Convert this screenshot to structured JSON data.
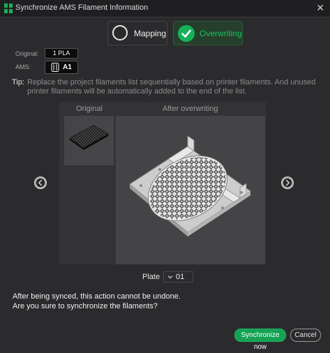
{
  "window": {
    "title": "Synchronize AMS Filament Information",
    "app_icon": "grid-app-icon"
  },
  "modes": {
    "mapping_label": "Mapping",
    "overwriting_label": "Overwriting",
    "selected": "Overwriting"
  },
  "filament": {
    "original_label": "Original:",
    "original_value": "1 PLA",
    "ams_label": "AMS:",
    "ams_value": "A1"
  },
  "tip": {
    "label": "Tip:",
    "text": "Replace the project filaments list sequentially based on printer filaments. And unused printer filaments will be automatically added to the end of the list."
  },
  "preview": {
    "original_header": "Original",
    "after_header": "After overwriting"
  },
  "plate": {
    "label": "Plate",
    "value": "01"
  },
  "warning": {
    "line1": "After being synced, this action cannot be undone.",
    "line2": "Are you sure to synchronize the filaments?"
  },
  "actions": {
    "sync_label": "Synchronize now",
    "cancel_label": "Cancel"
  },
  "colors": {
    "accent_green": "#16b058",
    "background": "#2b2b2e"
  }
}
